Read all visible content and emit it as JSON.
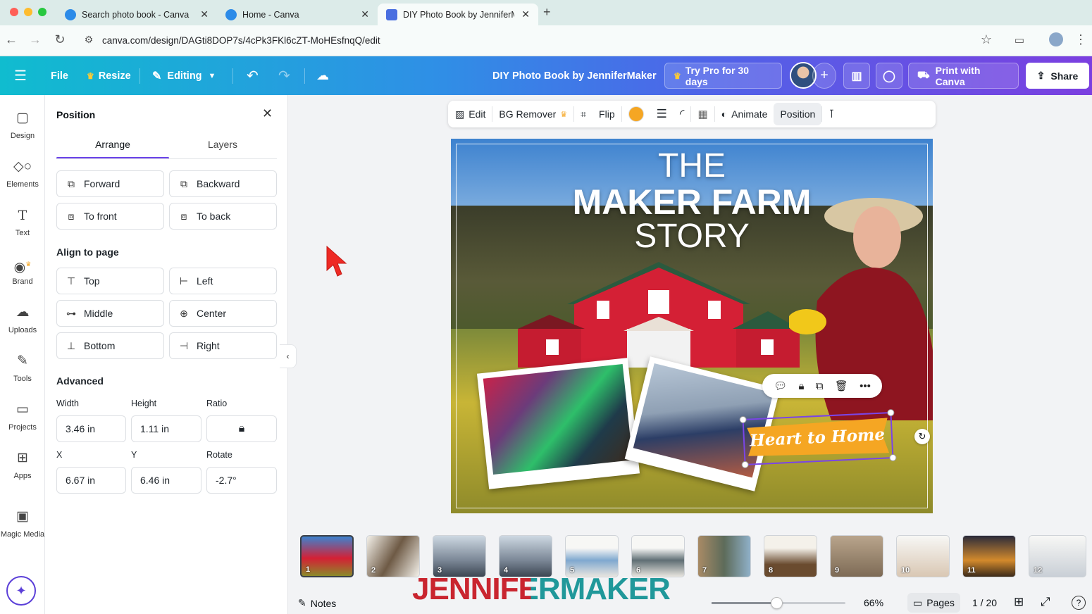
{
  "browser": {
    "tabs": [
      {
        "title": "Search photo book - Canva",
        "active": false
      },
      {
        "title": "Home - Canva",
        "active": false
      },
      {
        "title": "DIY Photo Book by JenniferM",
        "active": true
      }
    ],
    "url": "canva.com/design/DAGti8DOP7s/4cPk3FKl6cZT-MoHEsfnqQ/edit"
  },
  "header": {
    "file": "File",
    "resize": "Resize",
    "editing": "Editing",
    "doc_title": "DIY Photo Book by JenniferMaker",
    "try_pro": "Try Pro for 30 days",
    "print": "Print with Canva",
    "share": "Share"
  },
  "rail": [
    {
      "label": "Design",
      "icon": "design-icon"
    },
    {
      "label": "Elements",
      "icon": "elements-icon"
    },
    {
      "label": "Text",
      "icon": "text-icon"
    },
    {
      "label": "Brand",
      "icon": "brand-icon"
    },
    {
      "label": "Uploads",
      "icon": "uploads-icon"
    },
    {
      "label": "Tools",
      "icon": "tools-icon"
    },
    {
      "label": "Projects",
      "icon": "projects-icon"
    },
    {
      "label": "Apps",
      "icon": "apps-icon"
    },
    {
      "label": "Magic Media",
      "icon": "magic-media-icon"
    }
  ],
  "panel": {
    "title": "Position",
    "tabs": [
      "Arrange",
      "Layers"
    ],
    "arrange_buttons": [
      "Forward",
      "Backward",
      "To front",
      "To back"
    ],
    "align_title": "Align to page",
    "align_buttons": [
      "Top",
      "Left",
      "Middle",
      "Center",
      "Bottom",
      "Right"
    ],
    "advanced_title": "Advanced",
    "labels": {
      "width": "Width",
      "height": "Height",
      "ratio": "Ratio",
      "x": "X",
      "y": "Y",
      "rotate": "Rotate"
    },
    "values": {
      "width": "3.46 in",
      "height": "1.11 in",
      "x": "6.67 in",
      "y": "6.46 in",
      "rotate": "-2.7°"
    }
  },
  "context_toolbar": {
    "edit": "Edit",
    "bg_remover": "BG Remover",
    "flip": "Flip",
    "animate": "Animate",
    "position": "Position",
    "color": "#f5a623"
  },
  "canvas": {
    "title_line1": "THE",
    "title_line2": "MAKER FARM",
    "title_line3": "STORY",
    "banner": "Heart to Home"
  },
  "pages": [
    "1",
    "2",
    "3",
    "4",
    "5",
    "6",
    "7",
    "8",
    "9",
    "10",
    "11",
    "12"
  ],
  "bottom": {
    "notes": "Notes",
    "zoom": "66%",
    "pages_label": "Pages",
    "page_count": "1 / 20"
  },
  "watermark": "JENNIFERMAKER"
}
